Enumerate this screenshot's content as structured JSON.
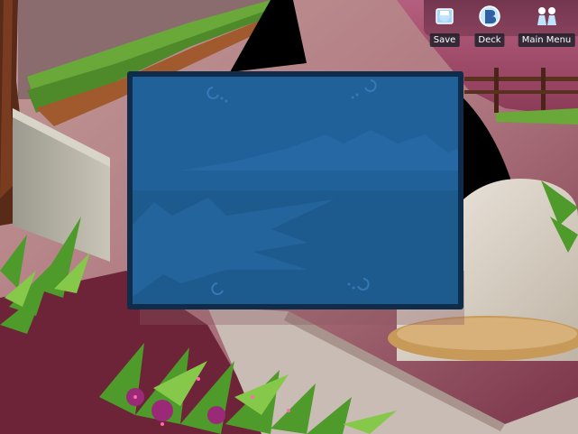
{
  "menu": {
    "items": [
      {
        "label": "Save",
        "icon": "save-icon"
      },
      {
        "label": "Deck",
        "icon": "deck-icon"
      },
      {
        "label": "Main Menu",
        "icon": "main-menu-icon"
      }
    ]
  },
  "dialog": {
    "text": ""
  },
  "colors": {
    "panel": "#1d5a8e",
    "panel_border": "#0f2d4a",
    "label_bg": "#14202a"
  }
}
